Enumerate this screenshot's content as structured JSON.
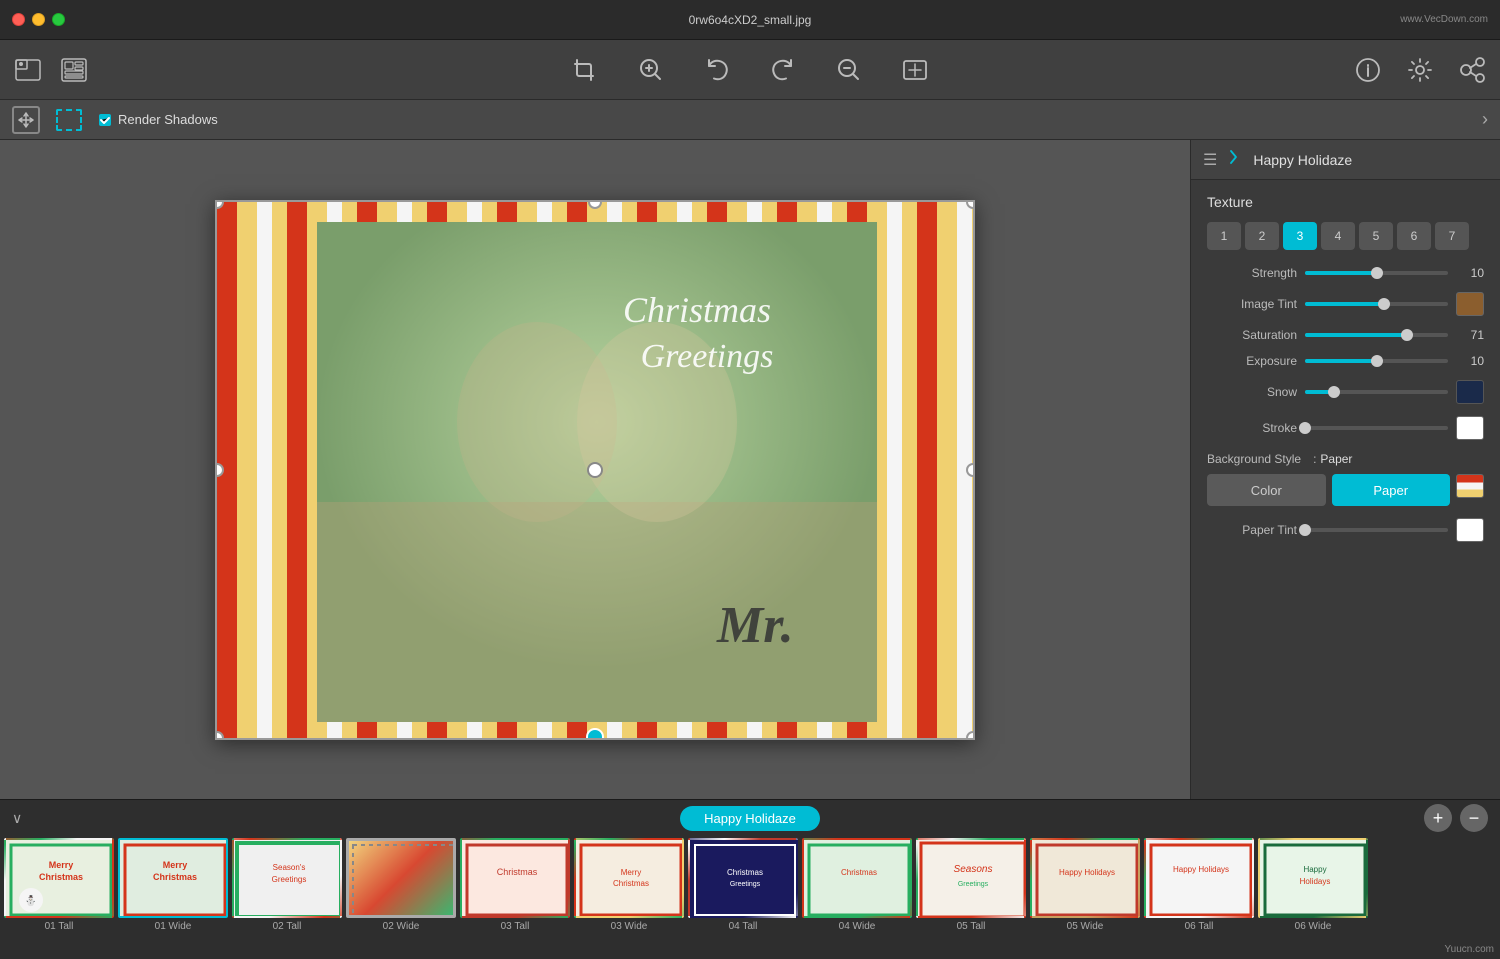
{
  "titlebar": {
    "filename": "0rw6o4cXD2_small.jpg",
    "watermark": "www.VecDown.com"
  },
  "toolbar": {
    "icons": [
      "photo-icon",
      "template-icon",
      "crop-icon",
      "zoom-in-icon",
      "rotate-left-icon",
      "rotate-right-icon",
      "zoom-out-icon",
      "fullscreen-icon"
    ],
    "right_icons": [
      "info-icon",
      "settings-icon",
      "share-icon"
    ]
  },
  "secondary_toolbar": {
    "render_shadows_label": "Render Shadows",
    "render_shadows_checked": true
  },
  "panel": {
    "title": "Happy Holidaze",
    "texture_label": "Texture",
    "texture_tabs": [
      "1",
      "2",
      "3",
      "4",
      "5",
      "6",
      "7"
    ],
    "active_tab": "3",
    "sliders": [
      {
        "label": "Strength",
        "value": 10,
        "percent": 50,
        "has_swatch": false
      },
      {
        "label": "Image Tint",
        "value": "",
        "percent": 55,
        "has_swatch": true,
        "swatch_color": "#8B5E2E"
      },
      {
        "label": "Saturation",
        "value": 71,
        "percent": 71,
        "has_swatch": false
      },
      {
        "label": "Exposure",
        "value": 10,
        "percent": 50,
        "has_swatch": false
      },
      {
        "label": "Snow",
        "value": "",
        "percent": 20,
        "has_swatch": true,
        "swatch_color": "#1a2a4a"
      },
      {
        "label": "Stroke",
        "value": "",
        "percent": 0,
        "has_swatch": true,
        "swatch_color": "#ffffff"
      }
    ],
    "bg_style_label": "Background Style",
    "bg_style_value": "Paper",
    "bg_buttons": [
      {
        "label": "Color",
        "active": false
      },
      {
        "label": "Paper",
        "active": true
      }
    ],
    "paper_tint_label": "Paper Tint",
    "paper_tint_percent": 0,
    "paper_swatch_color": "#ffffff",
    "bg_preview_colors": [
      "#d4341a",
      "#f5f5f5",
      "#f0d070"
    ]
  },
  "bottom": {
    "template_name": "Happy Holidaze",
    "thumbnails": [
      {
        "label": "01 Tall",
        "class": "th-christmas1",
        "selected": false
      },
      {
        "label": "01 Wide",
        "class": "th-christmas2",
        "selected": true
      },
      {
        "label": "02 Tall",
        "class": "th-christmas3",
        "selected": false
      },
      {
        "label": "02 Wide",
        "class": "th-christmas4",
        "selected": false
      },
      {
        "label": "03 Tall",
        "class": "th-5",
        "selected": false
      },
      {
        "label": "03 Wide",
        "class": "th-6",
        "selected": false
      },
      {
        "label": "04 Tall",
        "class": "th-7",
        "selected": false
      },
      {
        "label": "04 Wide",
        "class": "th-8",
        "selected": false
      },
      {
        "label": "05 Tall",
        "class": "th-9",
        "selected": false
      },
      {
        "label": "05 Wide",
        "class": "th-10",
        "selected": false
      },
      {
        "label": "06 Tall",
        "class": "th-11",
        "selected": false
      },
      {
        "label": "06 Wide",
        "class": "th-12",
        "selected": false
      }
    ],
    "watermark": "Yuucn.com"
  }
}
